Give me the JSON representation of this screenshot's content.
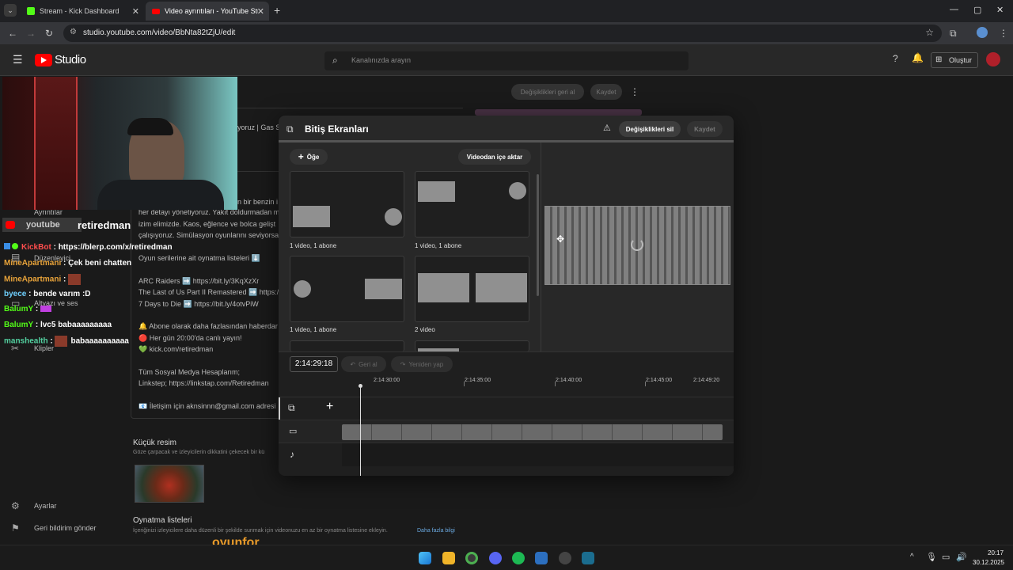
{
  "browser": {
    "tabs": [
      {
        "title": "Stream - Kick Dashboard"
      },
      {
        "title": "Video ayrıntıları - YouTube Studio"
      }
    ],
    "url": "studio.youtube.com/video/BbNta82tZjU/edit"
  },
  "studio": {
    "logo_text": "Studio",
    "search_placeholder": "Kanalınızda arayın",
    "create_label": "Oluştur",
    "top_actions": {
      "undo": "Değişiklikleri geri al",
      "save": "Kaydet"
    },
    "sidebar": [
      {
        "label": "Ayrıntılar",
        "icon": "pencil-icon"
      },
      {
        "label": "Düzenleyici",
        "icon": "film-icon"
      },
      {
        "label": "Altyazı ve ses",
        "icon": "subtitles-icon"
      },
      {
        "label": "Klipler",
        "icon": "scissors-icon"
      },
      {
        "label": "Ayarlar",
        "icon": "gear-icon"
      },
      {
        "label": "Geri bildirim gönder",
        "icon": "feedback-icon"
      }
    ],
    "description_lines": [
      "yoruz | Gas S",
      "n bir benzin i",
      "her detayı yönetiyoruz. Yakıt doldurmadan m",
      "izim elimizde. Kaos, eğlence ve bolca gelişt",
      "çalışıyoruz. Simülasyon oyunlarını seviyorsa",
      "Oyun serilerine ait oynatma listeleri ⬇️",
      "ARC Raiders ➡️ https://bit.ly/3KqXzXr",
      "The Last of Us Part II Remastered ➡️ https:/",
      "7 Days to Die ➡️ https://bit.ly/4otvPiW",
      "🔔 Abone olarak daha fazlasından haberdar",
      "🔴 Her gün 20:00'da canlı yayın!",
      "💚 kick.com/retiredman",
      "Tüm Sosyal Medya Hesaplarım;",
      "Linkstep; https://linkstap.com/Retiredman",
      "📧 İletişim için aknsinnn@gmail.com adresi"
    ],
    "thumbnail_title": "Küçük resim",
    "thumbnail_sub": "Göze çarpacak ve izleyicilerin dikkatini çekecek bir kü",
    "playlist_title": "Oynatma listeleri",
    "playlist_sub": "İçeriğinizi izleyicilere daha düzenli bir şekilde sunmak için videonuzu en az bir oynatma listesine ekleyin.",
    "playlist_link": "Daha fazla bilgi"
  },
  "overlay": {
    "yt_name": "retiredman",
    "chat": [
      {
        "user": "KickBot",
        "msg": "https://blerp.com/x/retiredman",
        "color": "#ff4d4d"
      },
      {
        "user": "MineApartmani",
        "msg": "Çek beni chatten",
        "color": "#e8a33a"
      },
      {
        "user": "MineApartmani",
        "msg": "",
        "color": "#e8a33a"
      },
      {
        "user": "byece",
        "msg": "bende varım :D",
        "color": "#6fd0ff"
      },
      {
        "user": "BalumY",
        "msg": "",
        "color": "#53fc18"
      },
      {
        "user": "BalumY",
        "msg": "lvc5 babaaaaaaaaa",
        "color": "#53fc18"
      },
      {
        "user": "manshealth",
        "msg": "babaaaaaaaaaa",
        "color": "#53d0a0"
      }
    ],
    "watermark": "oyunfor"
  },
  "modal": {
    "title": "Bitiş Ekranları",
    "delete_label": "Değişiklikleri sil",
    "save_label": "Kaydet",
    "add_item_label": "Öğe",
    "import_label": "Videodan içe aktar",
    "templates": [
      {
        "label": "1 video, 1 abone"
      },
      {
        "label": "1 video, 1 abone"
      },
      {
        "label": "1 video, 1 abone"
      },
      {
        "label": "2 video"
      }
    ],
    "timecode": "2:14:29:18",
    "undo_label": "Geri al",
    "redo_label": "Yeniden yap",
    "ticks": [
      "2:14:30:00",
      "2:14:35:00",
      "2:14:40:00",
      "2:14:45:00",
      "2:14:49:20"
    ]
  },
  "taskbar": {
    "time": "20:17",
    "date": "30.12.2025"
  }
}
